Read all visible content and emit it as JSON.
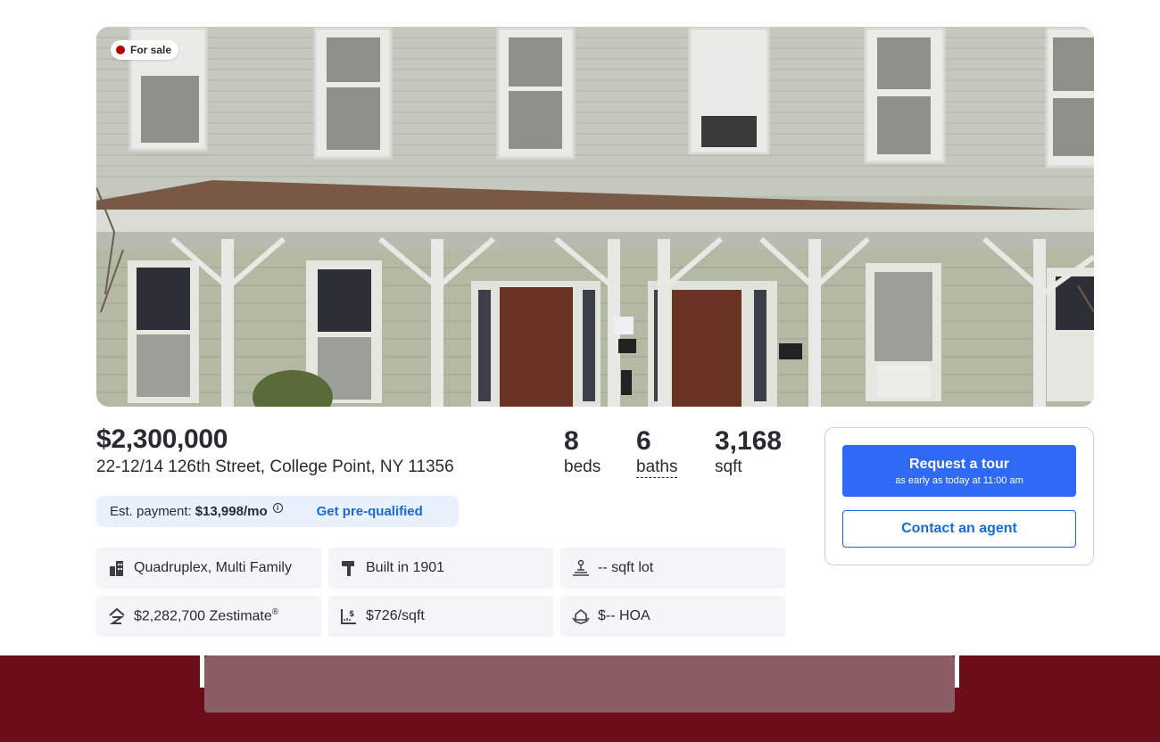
{
  "listing": {
    "status_label": "For sale",
    "price": "$2,300,000",
    "address": "22-12/14 126th Street, College Point, NY 11356"
  },
  "stats": {
    "beds": {
      "value": "8",
      "label": "beds"
    },
    "baths": {
      "value": "6",
      "label": "baths"
    },
    "sqft": {
      "value": "3,168",
      "label": "sqft"
    }
  },
  "payment": {
    "label": "Est. payment:",
    "amount": "$13,998/mo",
    "info_icon": "i",
    "prequal_link": "Get pre-qualified"
  },
  "facts": [
    {
      "icon": "building-icon",
      "text": "Quadruplex, Multi Family"
    },
    {
      "icon": "hammer-icon",
      "text": "Built in 1901"
    },
    {
      "icon": "lot-icon",
      "text": "-- sqft lot"
    },
    {
      "icon": "zestimate-icon",
      "text": "$2,282,700 Zestimate",
      "sup": "®"
    },
    {
      "icon": "price-per-sqft-icon",
      "text": "$726/sqft"
    },
    {
      "icon": "hoa-icon",
      "text": "$-- HOA"
    }
  ],
  "cta": {
    "tour_label": "Request a tour",
    "tour_sub": "as early as today at 11:00 am",
    "agent_label": "Contact an agent"
  },
  "colors": {
    "accent_blue": "#2e6af6",
    "link_blue": "#1a6ad6",
    "status_red": "#b30000",
    "bottom_band": "#6b0d18"
  }
}
